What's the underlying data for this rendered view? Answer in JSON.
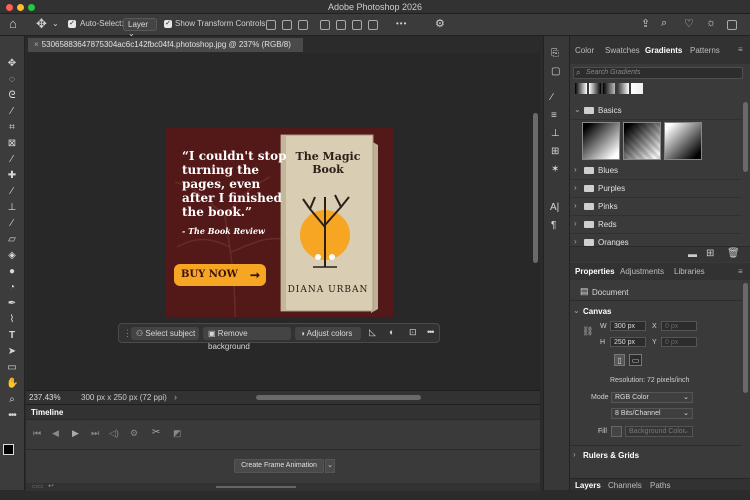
{
  "app_title": "Adobe Photoshop 2026",
  "options_bar": {
    "auto_select_label": "Auto-Select:",
    "auto_select_value": "Layer",
    "show_transform_label": "Show Transform Controls"
  },
  "document_tab": "530658836478753​04ac6c142fbc04f4.photoshop.jpg @ 237% (RGB/8)",
  "ad": {
    "quote": "“I couldn't stop turning the pages, even after I finished the book.”",
    "source": "- The Book Review",
    "cta": "BUY NOW",
    "book_title": "The Magic Book",
    "book_author": "DIANA URBAN"
  },
  "contextual_bar": {
    "select_subject": "Select subject",
    "remove_background": "Remove background",
    "adjust_colors": "Adjust colors"
  },
  "status": {
    "zoom": "237.43%",
    "doc_size": "300 px x 250 px (72 ppi)"
  },
  "timeline": {
    "title": "Timeline",
    "create_button": "Create Frame Animation"
  },
  "gradients_panel": {
    "tabs": [
      "Color",
      "Swatches",
      "Gradients",
      "Patterns"
    ],
    "search_placeholder": "Search Gradients",
    "groups": [
      "Basics",
      "Blues",
      "Purples",
      "Pinks",
      "Reds",
      "Oranges"
    ]
  },
  "properties_panel": {
    "tabs": [
      "Properties",
      "Adjustments",
      "Libraries"
    ],
    "document_label": "Document",
    "canvas_section": "Canvas",
    "w_label": "W",
    "w_value": "300 px",
    "h_label": "H",
    "h_value": "250 px",
    "x_label": "X",
    "x_placeholder": "0 px",
    "y_label": "Y",
    "y_placeholder": "0 px",
    "resolution": "Resolution: 72 pixels/inch",
    "mode_label": "Mode",
    "mode_value": "RGB Color",
    "bits_value": "8 Bits/Channel",
    "fill_label": "Fill",
    "fill_value": "Background Color",
    "rulers_section": "Rulers & Grids"
  },
  "layers_panel": {
    "tabs": [
      "Layers",
      "Channels",
      "Paths"
    ]
  },
  "colors": {
    "ad_bg": "#5a1a1a",
    "cta": "#f6a623",
    "sun": "#f6a623",
    "book_cover": "#d9cdb3"
  }
}
